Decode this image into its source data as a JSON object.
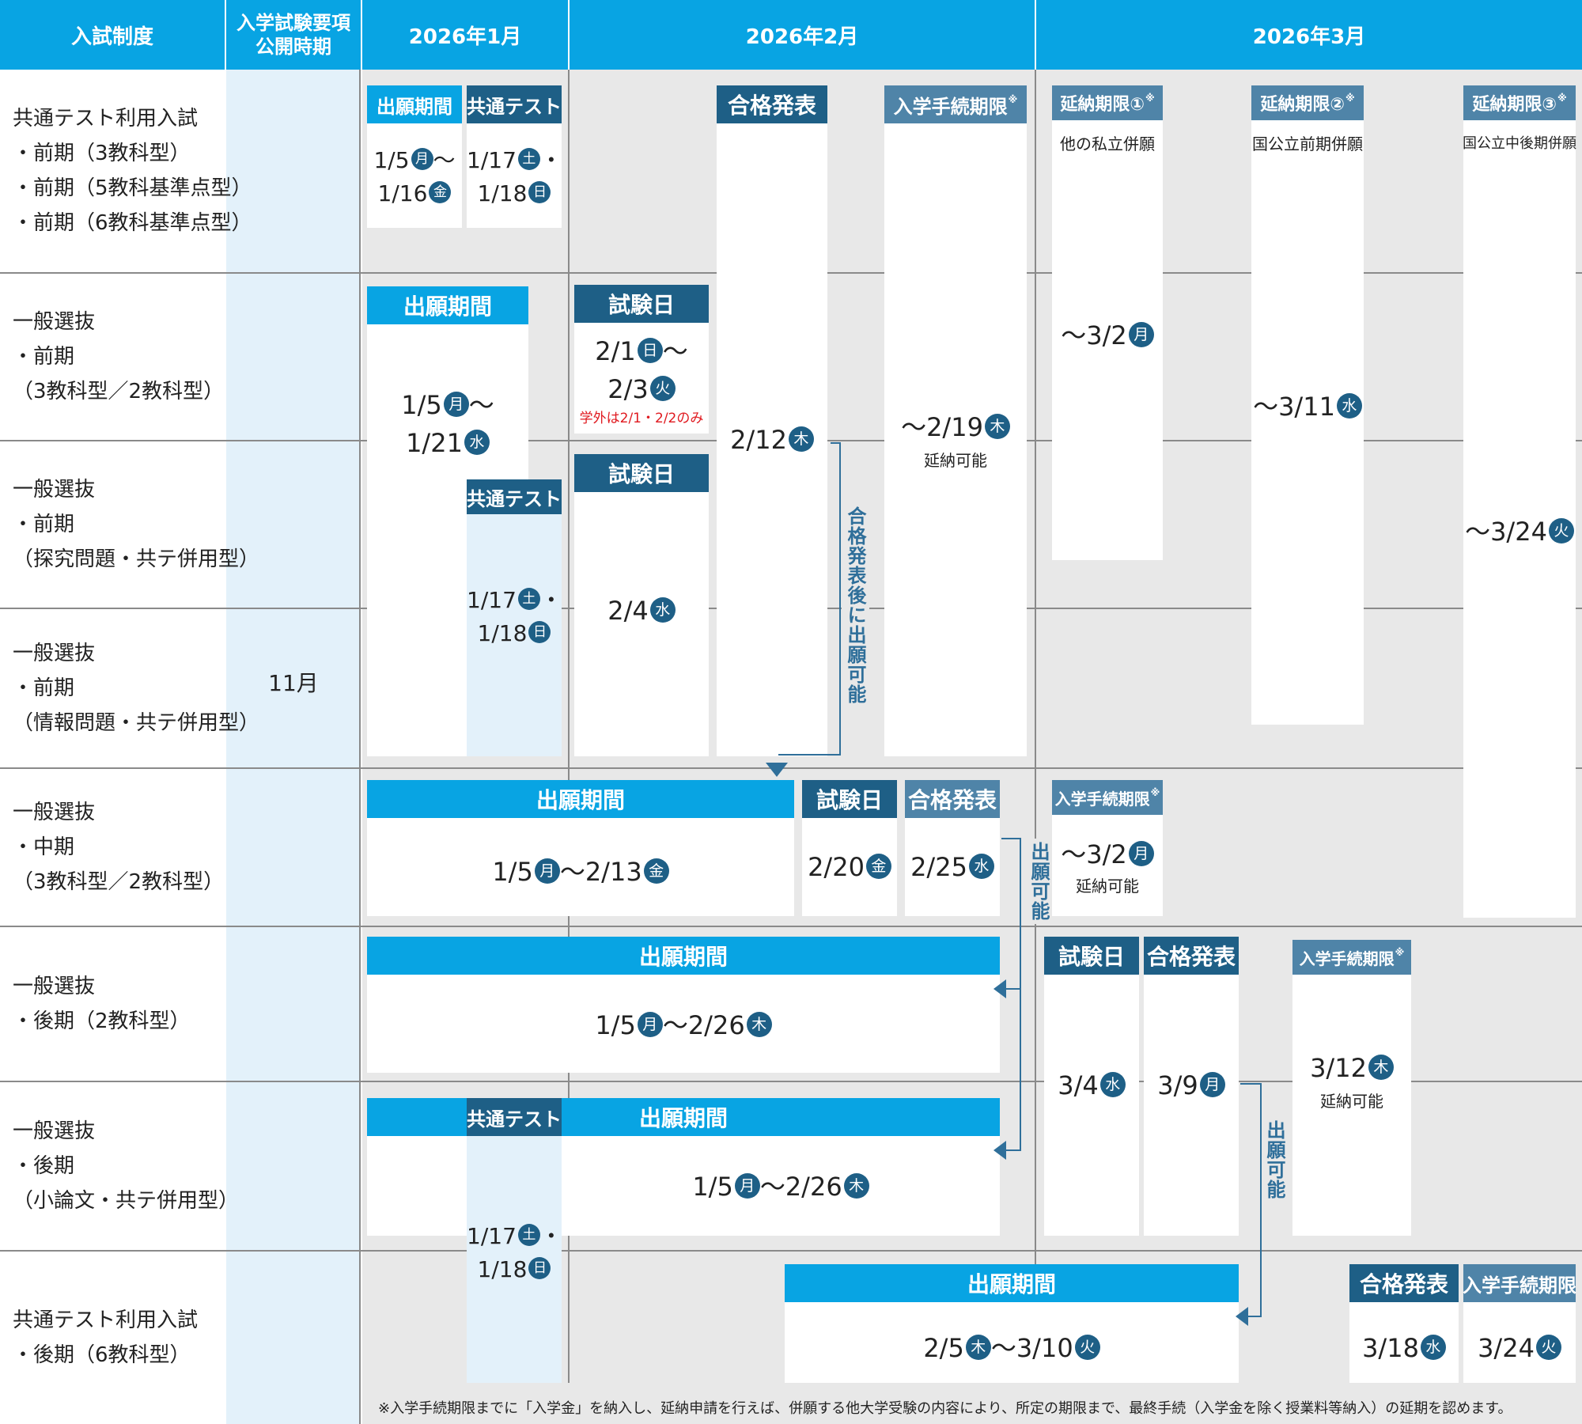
{
  "header": {
    "system": "入試制度",
    "guide_line1": "入学試験要項",
    "guide_line2": "公開時期",
    "jan": "2026年1月",
    "feb": "2026年2月",
    "mar": "2026年3月"
  },
  "guide_month": "11月",
  "rows": [
    {
      "lines": [
        "共通テスト利用入試",
        "・前期（3教科型）",
        "・前期（5教科基準点型）",
        "・前期（6教科基準点型）"
      ]
    },
    {
      "lines": [
        "一般選抜",
        "・前期",
        "（3教科型／2教科型）"
      ]
    },
    {
      "lines": [
        "一般選抜",
        "・前期",
        "（探究問題・共テ併用型）"
      ]
    },
    {
      "lines": [
        "一般選抜",
        "・前期",
        "（情報問題・共テ併用型）"
      ]
    },
    {
      "lines": [
        "一般選抜",
        "・中期",
        "（3教科型／2教科型）"
      ]
    },
    {
      "lines": [
        "一般選抜",
        "・後期（2教科型）"
      ]
    },
    {
      "lines": [
        "一般選抜",
        "・後期",
        "（小論文・共テ併用型）"
      ]
    },
    {
      "lines": [
        "共通テスト利用入試",
        "・後期（6教科型）"
      ]
    }
  ],
  "labels": {
    "application_period": "出願期間",
    "common_test": "共通テスト",
    "exam_day": "試験日",
    "result": "合格発表",
    "enrollment_deadline": "入学手続期限",
    "deferral_1": "延納期限①",
    "deferral_2": "延納期限②",
    "deferral_3": "延納期限③",
    "asterisk": "※"
  },
  "notes": {
    "other_private": "他の私立併願",
    "national_early": "国公立前期併願",
    "national_mid_late": "国公立中後期併願",
    "deferral_possible": "延納可能",
    "campus_only": "学外は2/1・2/2のみ",
    "apply_after_result": "合格発表後に出願可能",
    "apply_possible": "出願可能",
    "footnote": "※入学手続期限までに「入学金」を納入し、延納申請を行えば、併願する他大学受験の内容により、所定の期限まで、最終手続（入学金を除く授業料等納入）の延期を認めます。"
  },
  "dates": {
    "kyotsu_early_app_a": "1/5",
    "kyotsu_early_app_a_dow": "月",
    "kyotsu_early_app_b": "1/16",
    "kyotsu_early_app_b_dow": "金",
    "test_a": "1/17",
    "test_a_dow": "土",
    "test_b": "1/18",
    "test_b_dow": "日",
    "ippan_early_app_a": "1/5",
    "ippan_early_app_a_dow": "月",
    "ippan_early_app_b": "1/21",
    "ippan_early_app_b_dow": "水",
    "ippan_early_exam_a": "2/1",
    "ippan_early_exam_a_dow": "日",
    "ippan_early_exam_b": "2/3",
    "ippan_early_exam_b_dow": "火",
    "ippan_early_exam2": "2/4",
    "ippan_early_exam2_dow": "水",
    "early_result": "2/12",
    "early_result_dow": "木",
    "early_enroll": "〜2/19",
    "early_enroll_dow": "木",
    "deferral_1": "〜3/2",
    "deferral_1_dow": "月",
    "deferral_2": "〜3/11",
    "deferral_2_dow": "水",
    "deferral_3": "〜3/24",
    "deferral_3_dow": "火",
    "mid_app_a": "1/5",
    "mid_app_a_dow": "月",
    "mid_app_b": "〜2/13",
    "mid_app_b_dow": "金",
    "mid_exam": "2/20",
    "mid_exam_dow": "金",
    "mid_result": "2/25",
    "mid_result_dow": "水",
    "mid_enroll": "〜3/2",
    "mid_enroll_dow": "月",
    "late_app_a": "1/5",
    "late_app_a_dow": "月",
    "late_app_b": "〜2/26",
    "late_app_b_dow": "木",
    "late_exam": "3/4",
    "late_exam_dow": "水",
    "late_result": "3/9",
    "late_result_dow": "月",
    "late_enroll": "3/12",
    "late_enroll_dow": "木",
    "kyotsu_late_app_a": "2/5",
    "kyotsu_late_app_a_dow": "木",
    "kyotsu_late_app_b": "〜3/10",
    "kyotsu_late_app_b_dow": "火",
    "kyotsu_late_result": "3/18",
    "kyotsu_late_result_dow": "水",
    "kyotsu_late_enroll": "3/24",
    "kyotsu_late_enroll_dow": "火"
  },
  "colors": {
    "header_blue": "#08a4e3",
    "label_dark": "#1e5f86",
    "label_gray": "#4f84a8",
    "band_gray": "#e8e8e8",
    "pale_blue": "#e3f1fa",
    "accent_red": "#e0191f"
  }
}
